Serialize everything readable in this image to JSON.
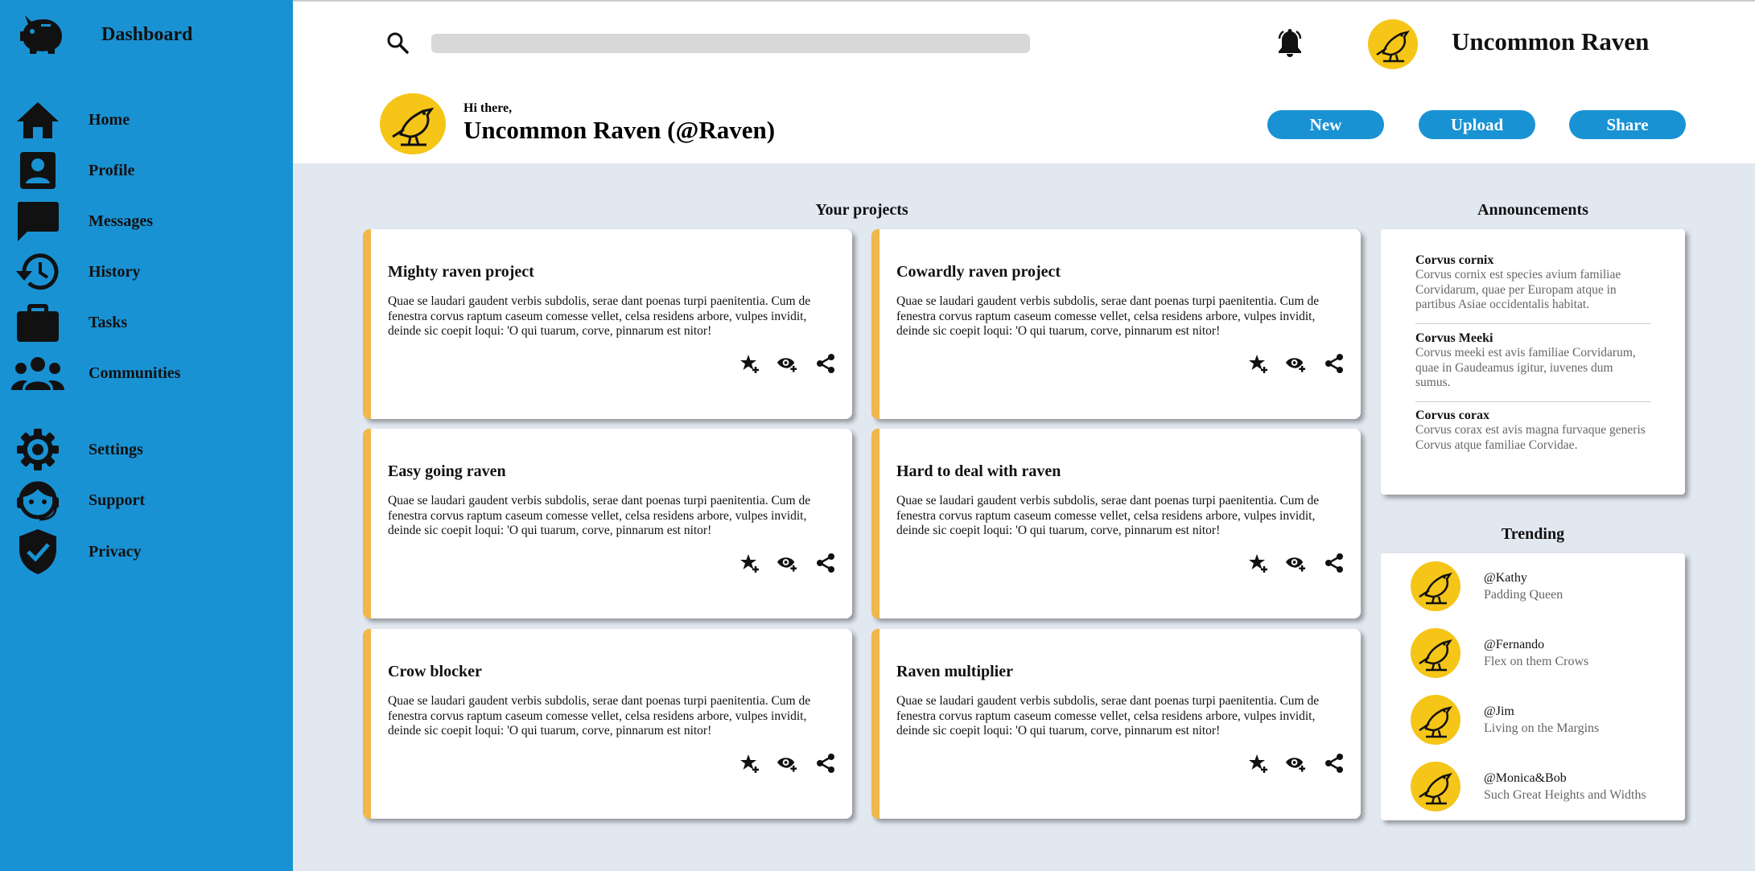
{
  "sidebar": {
    "brand": "Dashboard",
    "items": [
      {
        "label": "Home",
        "icon": "home-icon"
      },
      {
        "label": "Profile",
        "icon": "profile-icon"
      },
      {
        "label": "Messages",
        "icon": "messages-icon"
      },
      {
        "label": "History",
        "icon": "history-icon"
      },
      {
        "label": "Tasks",
        "icon": "tasks-icon"
      },
      {
        "label": "Communities",
        "icon": "communities-icon"
      },
      {
        "label": "Settings",
        "icon": "gear-icon"
      },
      {
        "label": "Support",
        "icon": "support-icon"
      },
      {
        "label": "Privacy",
        "icon": "shield-icon"
      }
    ]
  },
  "header": {
    "search_placeholder": "",
    "user_name": "Uncommon Raven",
    "greeting": "Hi there,",
    "full_name": "Uncommon Raven (@Raven)",
    "buttons": {
      "new": "New",
      "upload": "Upload",
      "share": "Share"
    }
  },
  "projects": {
    "title": "Your projects",
    "items": [
      {
        "title": "Mighty raven project",
        "body": "Quae se laudari gaudent verbis subdolis, serae dant poenas turpi paenitentia. Cum de fenestra corvus raptum caseum comesse vellet, celsa residens arbore, vulpes invidit, deinde sic coepit loqui: 'O qui tuarum, corve, pinnarum est nitor!"
      },
      {
        "title": "Cowardly raven project",
        "body": "Quae se laudari gaudent verbis subdolis, serae dant poenas turpi paenitentia. Cum de fenestra corvus raptum caseum comesse vellet, celsa residens arbore, vulpes invidit, deinde sic coepit loqui: 'O qui tuarum, corve, pinnarum est nitor!"
      },
      {
        "title": "Easy going raven",
        "body": "Quae se laudari gaudent verbis subdolis, serae dant poenas turpi paenitentia. Cum de fenestra corvus raptum caseum comesse vellet, celsa residens arbore, vulpes invidit, deinde sic coepit loqui: 'O qui tuarum, corve, pinnarum est nitor!"
      },
      {
        "title": "Hard to deal with raven",
        "body": "Quae se laudari gaudent verbis subdolis, serae dant poenas turpi paenitentia. Cum de fenestra corvus raptum caseum comesse vellet, celsa residens arbore, vulpes invidit, deinde sic coepit loqui: 'O qui tuarum, corve, pinnarum est nitor!"
      },
      {
        "title": "Crow blocker",
        "body": "Quae se laudari gaudent verbis subdolis, serae dant poenas turpi paenitentia. Cum de fenestra corvus raptum caseum comesse vellet, celsa residens arbore, vulpes invidit, deinde sic coepit loqui: 'O qui tuarum, corve, pinnarum est nitor!"
      },
      {
        "title": "Raven multiplier",
        "body": "Quae se laudari gaudent verbis subdolis, serae dant poenas turpi paenitentia. Cum de fenestra corvus raptum caseum comesse vellet, celsa residens arbore, vulpes invidit, deinde sic coepit loqui: 'O qui tuarum, corve, pinnarum est nitor!"
      }
    ]
  },
  "announcements": {
    "title": "Announcements",
    "items": [
      {
        "title": "Corvus cornix",
        "body": "Corvus cornix est species avium familiae Corvidarum, quae per Europam atque in partibus Asiae occidentalis habitat."
      },
      {
        "title": "Corvus Meeki",
        "body": "Corvus meeki est avis familiae Corvidarum, quae in Gaudeamus igitur, iuvenes dum sumus."
      },
      {
        "title": "Corvus corax",
        "body": "Corvus corax est avis magna furvaque generis Corvus atque familiae Corvidae."
      }
    ]
  },
  "trending": {
    "title": "Trending",
    "items": [
      {
        "handle": "@Kathy",
        "subtitle": "Padding Queen"
      },
      {
        "handle": "@Fernando",
        "subtitle": "Flex on them Crows"
      },
      {
        "handle": "@Jim",
        "subtitle": "Living on the Margins"
      },
      {
        "handle": "@Monica&Bob",
        "subtitle": "Such Great Heights and Widths"
      }
    ]
  },
  "colors": {
    "sidebar": "#1992d4",
    "accent": "#f0b74a",
    "avatar": "#f5c518",
    "background": "#e2e8f0"
  }
}
